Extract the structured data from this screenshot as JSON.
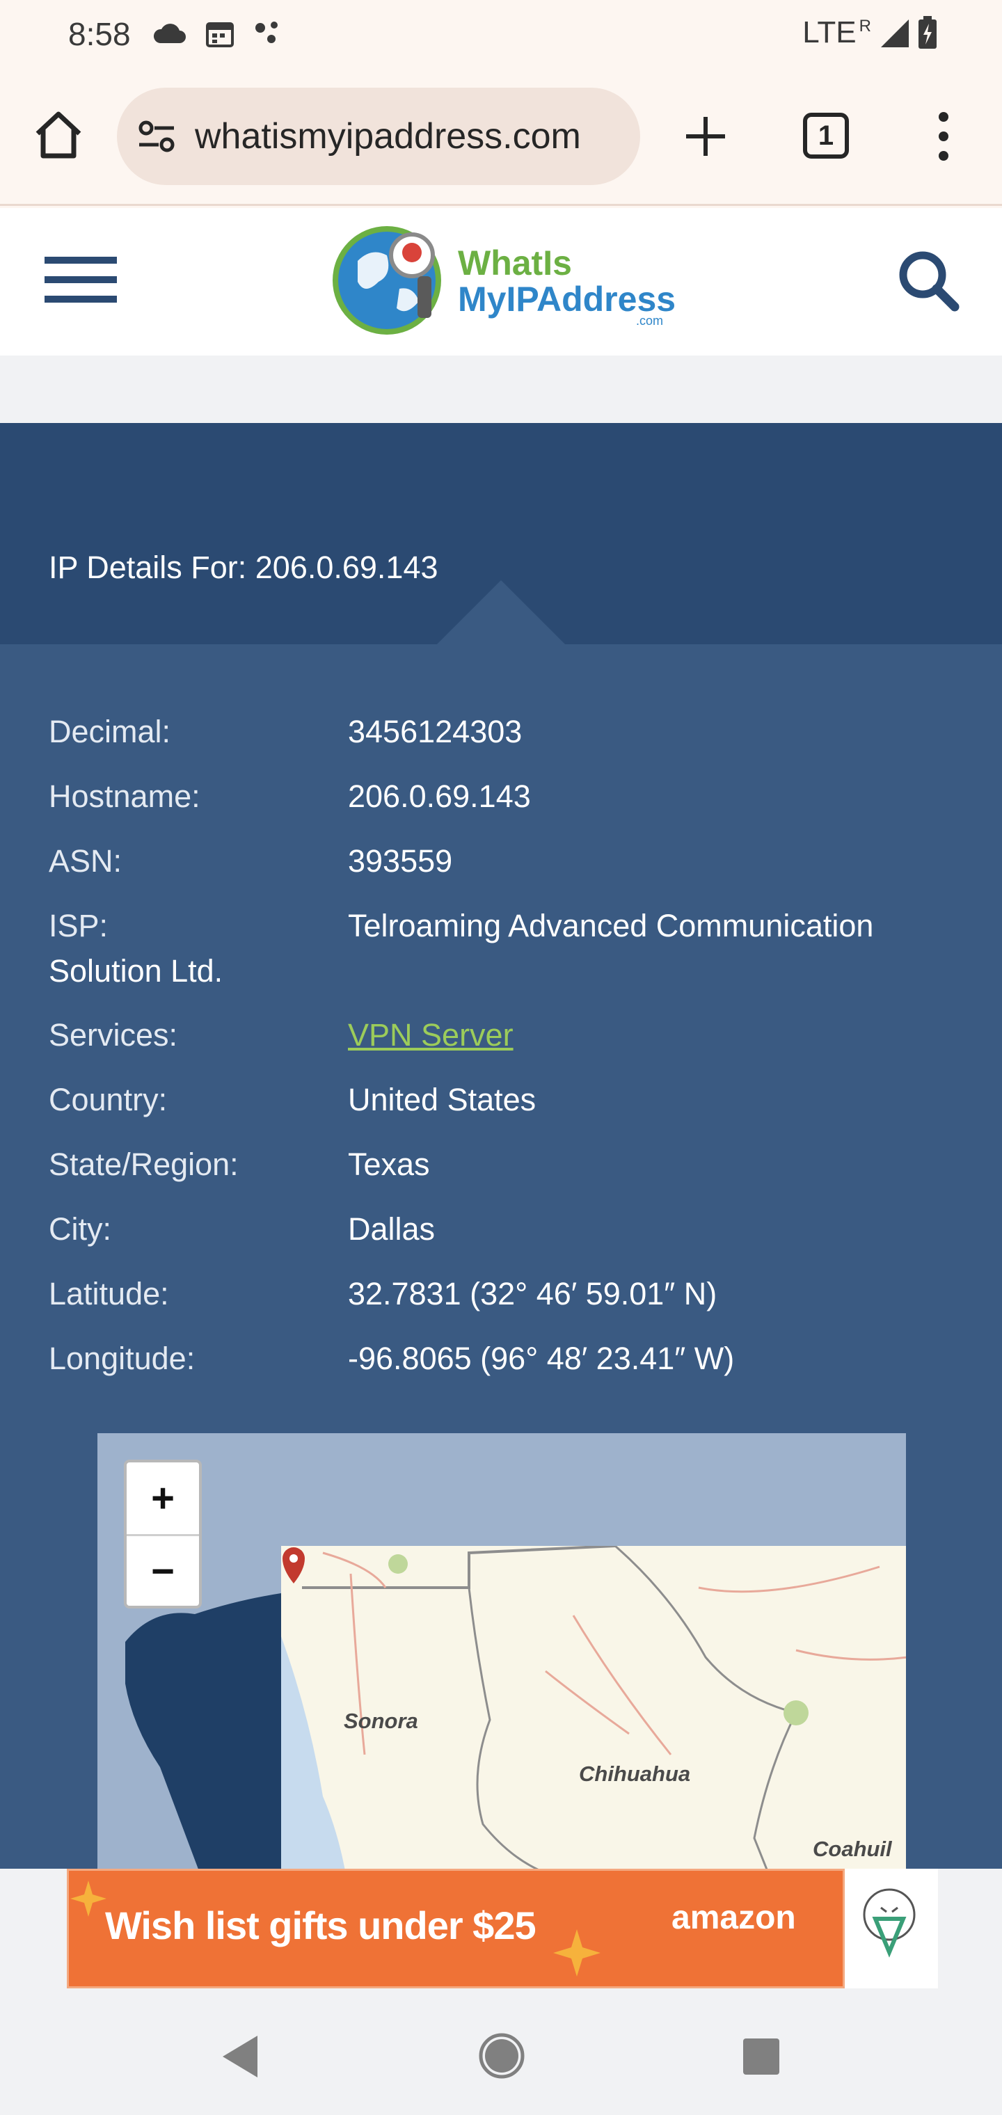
{
  "status_bar": {
    "time": "8:58",
    "network": "LTE",
    "roaming": "R"
  },
  "browser": {
    "url": "whatismyipaddress.com",
    "tab_count": "1"
  },
  "site": {
    "logo_line1": "WhatIs",
    "logo_line2": "MyIPAddress",
    "logo_domain": ".com"
  },
  "ip_details": {
    "title": "IP Details For: 206.0.69.143",
    "rows": [
      {
        "label": "Decimal:",
        "value": "3456124303"
      },
      {
        "label": "Hostname:",
        "value": "206.0.69.143"
      },
      {
        "label": "ASN:",
        "value": "393559"
      },
      {
        "label": "ISP:",
        "value": "Telroaming Advanced Communication",
        "continuation": "Solution Ltd."
      },
      {
        "label": "Services:",
        "value": "VPN Server"
      },
      {
        "label": "Country:",
        "value": "United States"
      },
      {
        "label": "State/Region:",
        "value": "Texas"
      },
      {
        "label": "City:",
        "value": "Dallas"
      },
      {
        "label": "Latitude:",
        "value": "32.7831 (32° 46′ 59.01″ N)"
      },
      {
        "label": "Longitude:",
        "value": "-96.8065 (96° 48′ 23.41″ W)"
      }
    ]
  },
  "map": {
    "zoom_in": "+",
    "zoom_out": "−",
    "labels": [
      "Sonora",
      "Chihuahua",
      "Coahuil"
    ]
  },
  "ad": {
    "text": "Wish list gifts under $25",
    "brand": "amazon"
  },
  "colors": {
    "header_blue": "#2b4a72",
    "panel_blue": "#3a5a82",
    "link_green": "#9ccc5a",
    "ad_orange": "#ef7236"
  }
}
